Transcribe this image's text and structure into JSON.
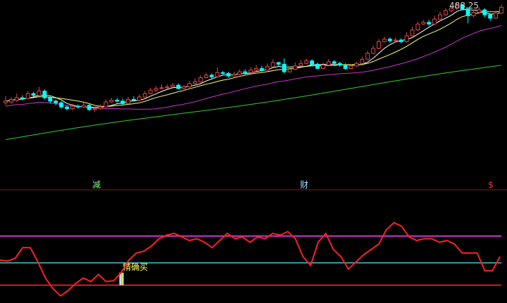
{
  "chart_data": [
    {
      "type": "candlestick",
      "price_label": "488.25",
      "marker_labels": [
        {
          "text": "减",
          "color": "#7fff7f"
        },
        {
          "text": "财",
          "color": "#9fdcff"
        },
        {
          "text": "$",
          "color": "#ff3030"
        }
      ],
      "colors": {
        "up": "#e04848",
        "down": "#00ffff",
        "ma1": "#ffffff",
        "ma2": "#ffff66",
        "ma3": "#cc33cc",
        "ma4": "#33cc33"
      },
      "candles": [
        [
          372,
          374,
          380,
          369
        ],
        [
          373,
          376,
          379,
          371
        ],
        [
          375,
          378,
          383,
          373
        ],
        [
          378,
          377,
          381,
          375
        ],
        [
          377,
          383,
          386,
          376
        ],
        [
          383,
          381,
          385,
          379
        ],
        [
          381,
          386,
          391,
          380
        ],
        [
          386,
          378,
          388,
          376
        ],
        [
          378,
          374,
          380,
          371
        ],
        [
          374,
          372,
          376,
          369
        ],
        [
          372,
          367,
          374,
          365
        ],
        [
          367,
          365,
          369,
          363
        ],
        [
          365,
          368,
          371,
          363
        ],
        [
          368,
          367,
          370,
          365
        ],
        [
          367,
          369,
          372,
          366
        ],
        [
          369,
          364,
          371,
          362
        ],
        [
          364,
          365,
          367,
          361
        ],
        [
          365,
          367,
          370,
          364
        ],
        [
          367,
          373,
          376,
          366
        ],
        [
          373,
          375,
          378,
          372
        ],
        [
          375,
          374,
          378,
          372
        ],
        [
          374,
          371,
          377,
          369
        ],
        [
          371,
          376,
          379,
          370
        ],
        [
          376,
          375,
          380,
          374
        ],
        [
          375,
          379,
          382,
          374
        ],
        [
          379,
          383,
          386,
          378
        ],
        [
          383,
          387,
          390,
          382
        ],
        [
          387,
          389,
          392,
          385
        ],
        [
          389,
          390,
          394,
          388
        ],
        [
          390,
          391,
          394,
          389
        ],
        [
          391,
          393,
          396,
          390
        ],
        [
          393,
          389,
          395,
          388
        ],
        [
          389,
          391,
          393,
          388
        ],
        [
          391,
          395,
          398,
          390
        ],
        [
          395,
          397,
          401,
          394
        ],
        [
          397,
          402,
          405,
          396
        ],
        [
          402,
          405,
          408,
          401
        ],
        [
          405,
          403,
          407,
          401
        ],
        [
          403,
          408,
          414,
          402
        ],
        [
          408,
          407,
          410,
          405
        ],
        [
          407,
          404,
          409,
          402
        ],
        [
          404,
          406,
          409,
          403
        ],
        [
          406,
          409,
          412,
          405
        ],
        [
          409,
          408,
          412,
          406
        ],
        [
          408,
          411,
          415,
          407
        ],
        [
          411,
          413,
          417,
          410
        ],
        [
          413,
          411,
          416,
          409
        ],
        [
          411,
          415,
          419,
          410
        ],
        [
          415,
          420,
          424,
          414
        ],
        [
          420,
          418,
          421,
          416
        ],
        [
          418,
          409,
          425,
          407
        ],
        [
          409,
          412,
          415,
          408
        ],
        [
          412,
          416,
          420,
          411
        ],
        [
          416,
          419,
          423,
          415
        ],
        [
          419,
          422,
          425,
          418
        ],
        [
          422,
          418,
          424,
          416
        ],
        [
          418,
          413,
          420,
          412
        ],
        [
          413,
          417,
          420,
          412
        ],
        [
          417,
          421,
          424,
          416
        ],
        [
          421,
          419,
          423,
          417
        ],
        [
          419,
          417,
          421,
          415
        ],
        [
          417,
          413,
          419,
          411
        ],
        [
          413,
          416,
          418,
          412
        ],
        [
          416,
          419,
          421,
          415
        ],
        [
          419,
          424,
          427,
          418
        ],
        [
          424,
          431,
          434,
          423
        ],
        [
          431,
          437,
          440,
          430
        ],
        [
          437,
          445,
          448,
          436
        ],
        [
          445,
          448,
          451,
          444
        ],
        [
          448,
          446,
          450,
          444
        ],
        [
          446,
          447,
          450,
          445
        ],
        [
          447,
          445,
          449,
          443
        ],
        [
          445,
          452,
          456,
          444
        ],
        [
          452,
          459,
          463,
          451
        ],
        [
          459,
          466,
          469,
          458
        ],
        [
          466,
          468,
          471,
          465
        ],
        [
          468,
          466,
          471,
          464
        ],
        [
          466,
          472,
          476,
          465
        ],
        [
          472,
          477,
          481,
          471
        ],
        [
          477,
          482,
          485,
          476
        ],
        [
          482,
          485,
          488,
          480
        ],
        [
          485,
          489,
          491,
          483
        ],
        [
          489,
          484,
          490,
          482
        ],
        [
          484,
          476,
          486,
          467
        ],
        [
          476,
          480,
          483,
          474
        ],
        [
          480,
          483,
          486,
          479
        ],
        [
          483,
          477,
          485,
          474
        ],
        [
          477,
          473,
          479,
          470
        ],
        [
          473,
          479,
          482,
          472
        ],
        [
          479,
          486,
          489,
          478
        ]
      ],
      "oscillator": {
        "ylim": [
          0,
          100
        ],
        "levels": {
          "high": 75,
          "mid": 45,
          "low": 20
        },
        "values": [
          48,
          47,
          50,
          62,
          62,
          46,
          28,
          16,
          8,
          14,
          22,
          28,
          24,
          32,
          24,
          25,
          34,
          48,
          56,
          58,
          64,
          72,
          76,
          78,
          74,
          70,
          72,
          68,
          62,
          70,
          78,
          72,
          74,
          68,
          74,
          72,
          78,
          76,
          80,
          72,
          52,
          42,
          68,
          78,
          60,
          52,
          38,
          46,
          54,
          60,
          66,
          82,
          90,
          86,
          74,
          70,
          72,
          72,
          68,
          70,
          66,
          56,
          56,
          56,
          36,
          36,
          52
        ],
        "buy_signal": {
          "index": 16,
          "label": "精确买"
        }
      }
    }
  ]
}
